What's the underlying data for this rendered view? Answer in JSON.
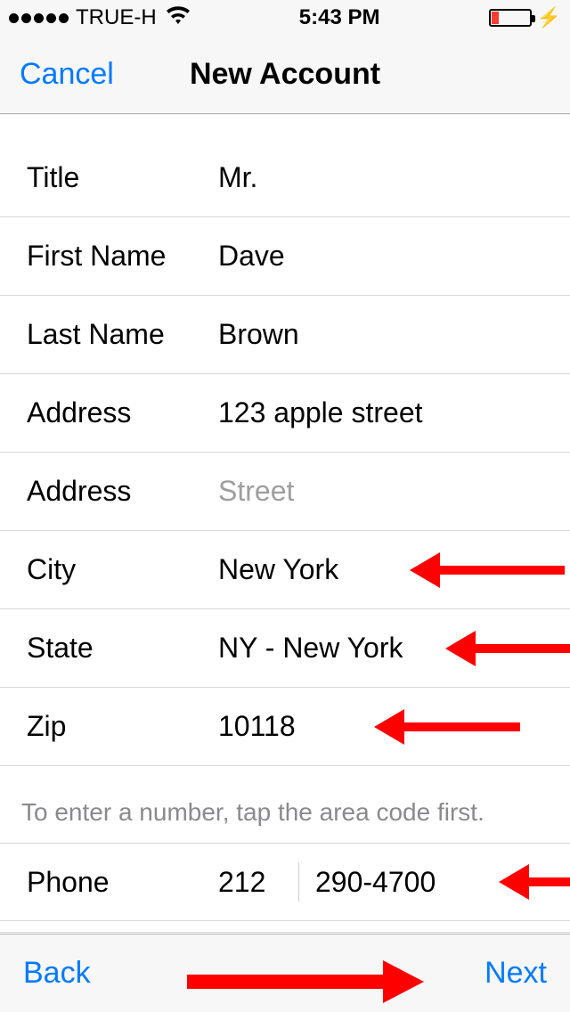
{
  "status": {
    "carrier": "TRUE-H",
    "time": "5:43 PM"
  },
  "nav": {
    "cancel": "Cancel",
    "title": "New Account"
  },
  "fields": {
    "title": {
      "label": "Title",
      "value": "Mr."
    },
    "firstName": {
      "label": "First Name",
      "value": "Dave"
    },
    "lastName": {
      "label": "Last Name",
      "value": "Brown"
    },
    "address1": {
      "label": "Address",
      "value": "123 apple street"
    },
    "address2": {
      "label": "Address",
      "placeholder": "Street"
    },
    "city": {
      "label": "City",
      "value": "New York"
    },
    "state": {
      "label": "State",
      "value": "NY - New York"
    },
    "zip": {
      "label": "Zip",
      "value": "10118"
    }
  },
  "phoneHint": "To enter a number, tap the area code first.",
  "phone": {
    "label": "Phone",
    "area": "212",
    "number": "290-4700"
  },
  "toolbar": {
    "back": "Back",
    "next": "Next"
  }
}
